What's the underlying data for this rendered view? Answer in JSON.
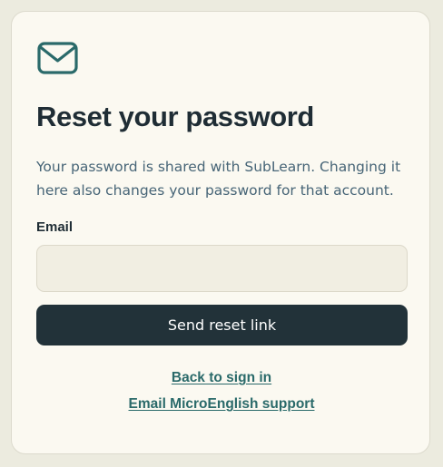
{
  "icon": "mail-icon",
  "colors": {
    "accent": "#2a6a6a",
    "button_bg": "#223239",
    "title_text": "#1f2d35",
    "body_text": "#476577"
  },
  "title": "Reset your password",
  "description": {
    "line1": "Your password is shared with SubLearn. Changing it",
    "line2": "here also changes your password for that account."
  },
  "email": {
    "label": "Email",
    "value": "",
    "placeholder": ""
  },
  "send_button_label": "Send reset link",
  "links": {
    "back_to_sign_in": "Back to sign in",
    "email_support": "Email MicroEnglish support"
  }
}
